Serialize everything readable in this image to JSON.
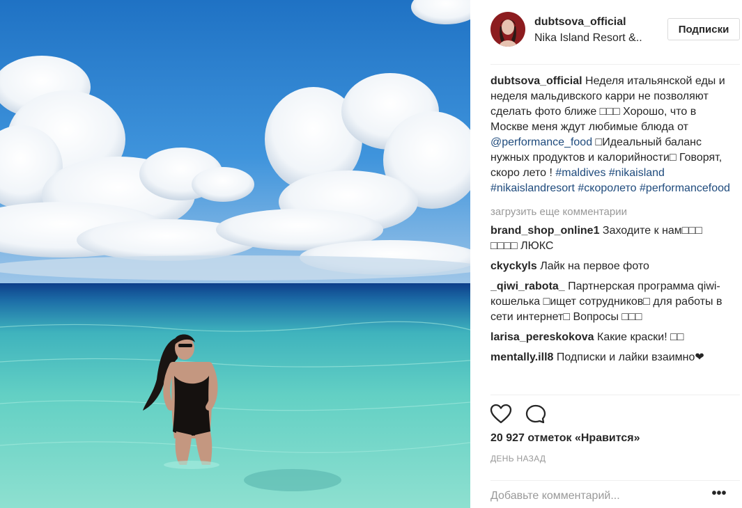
{
  "post": {
    "photo": {
      "description_icon": "beach-photo"
    },
    "header": {
      "username": "dubtsova_official",
      "location": "Nika Island Resort &..",
      "follow_label": "Подписки"
    },
    "caption": {
      "username": "dubtsova_official",
      "text_1": " Неделя итальянской еды и неделя мальдивского карри не позволяют сделать фото ближе □□□ Хорошо, что в Москве меня ждут любимые блюда от ",
      "mention": "@performance_food",
      "text_2": " □Идеальный баланс нужных продуктов и калорийности□ Говорят, скоро лето ! ",
      "hashtags": [
        "#maldives",
        "#nikaisland",
        "#nikaislandresort",
        "#скоролето",
        "#performancefood"
      ]
    },
    "load_more_label": "загрузить еще комментарии",
    "comments": [
      {
        "user": "brand_shop_online1",
        "text": "Заходите к нам□□□ □□□□ ЛЮКС"
      },
      {
        "user": "ckyckyls",
        "text": "Лайк на первое фото"
      },
      {
        "user": "_qiwi_rabota_",
        "text": "Партнерская программа qiwi-кошелька □ищет сотрудников□ для работы в сети интернет□ Вопросы □□□"
      },
      {
        "user": "larisa_pereskokova",
        "text": "Какие краски! □□"
      },
      {
        "user": "mentally.ill8",
        "text": "Подписки и лайки взаимно❤"
      }
    ],
    "likes_text": "20 927 отметок «Нравится»",
    "time_text": "ДЕНЬ НАЗАД",
    "comment_placeholder": "Добавьте комментарий...",
    "more_label": "•••",
    "icons": {
      "like": "heart-icon",
      "comment": "comment-bubble-icon",
      "more": "more-options-icon"
    },
    "colors": {
      "link": "#1e4a7c",
      "muted": "#999999",
      "border": "#dbdbdb"
    }
  }
}
